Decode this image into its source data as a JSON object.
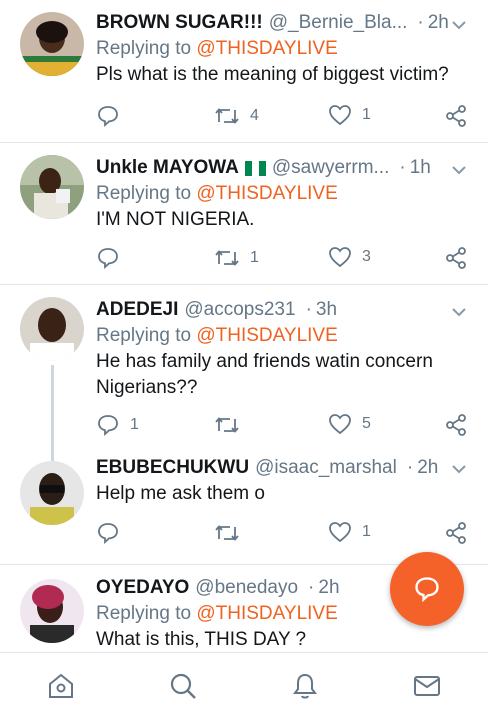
{
  "theme": {
    "accent": "#f4622a",
    "mention": "#f0621f",
    "muted": "#657786",
    "divider": "#e1e8ed"
  },
  "tweets": [
    {
      "name": "BROWN SUGAR!!!",
      "handle": "@_Bernie_Bla...",
      "time": "2h",
      "replying_prefix": "Replying to",
      "replying_to": "@THISDAYLIVE",
      "text": "Pls what is the meaning of biggest victim?",
      "retweets": "4",
      "likes": "1"
    },
    {
      "name": "Unkle MAYOWA",
      "flag": "nigeria-flag",
      "handle": "@sawyerrm...",
      "time": "1h",
      "replying_prefix": "Replying to",
      "replying_to": "@THISDAYLIVE",
      "text": "I'M NOT NIGERIA.",
      "retweets": "1",
      "likes": "3"
    },
    {
      "name": "ADEDEJI",
      "handle": "@accops231",
      "time": "3h",
      "replying_prefix": "Replying to",
      "replying_to": "@THISDAYLIVE",
      "text": "He has family and friends watin concern Nigerians??",
      "replies": "1",
      "retweets": "",
      "likes": "5"
    },
    {
      "name": "EBUBECHUKWU",
      "handle": "@isaac_marshal",
      "time": "2h",
      "text": "Help me ask them o",
      "retweets": "",
      "likes": "1"
    },
    {
      "name": "OYEDAYO",
      "handle": "@benedayo",
      "time": "2h",
      "replying_prefix": "Replying to",
      "replying_to": "@THISDAYLIVE",
      "text": "What is this, THIS DAY ?"
    }
  ],
  "nav": {
    "items": [
      "home-icon",
      "search-icon",
      "notifications-icon",
      "messages-icon"
    ]
  },
  "fab": {
    "icon": "compose-reply-icon"
  }
}
